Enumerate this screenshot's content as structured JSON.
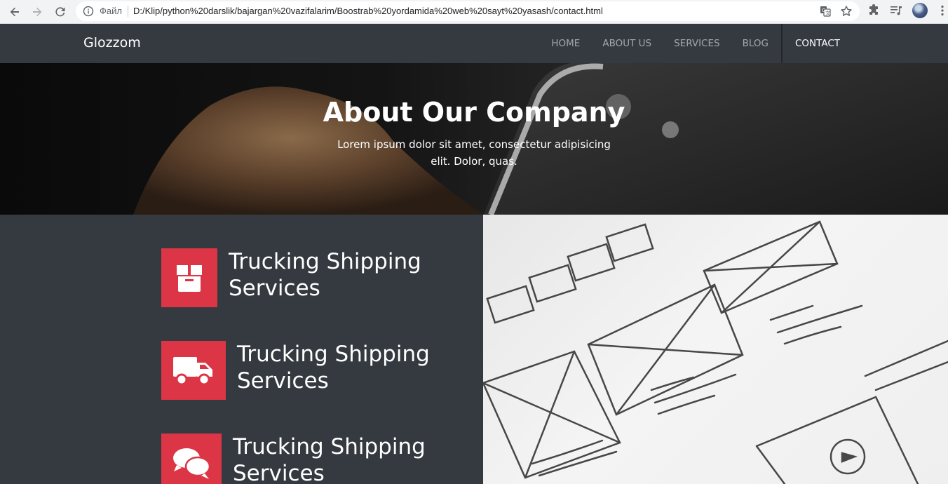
{
  "browser": {
    "scheme_label": "Файл",
    "url": "D:/Klip/python%20darslik/bajargan%20vazifalarim/Boostrab%20yordamida%20web%20sayt%20yasash/contact.html",
    "icons": [
      "back-icon",
      "forward-icon",
      "reload-icon",
      "info-icon",
      "translate-icon",
      "star-icon",
      "extensions-icon",
      "media-icon",
      "profile-avatar",
      "menu-icon"
    ]
  },
  "navbar": {
    "brand": "Glozzom",
    "links": [
      {
        "label": "HOME",
        "active": false
      },
      {
        "label": "ABOUT US",
        "active": false
      },
      {
        "label": "SERVICES",
        "active": false
      },
      {
        "label": "BLOG",
        "active": false
      },
      {
        "label": "CONTACT",
        "active": true
      }
    ]
  },
  "hero": {
    "title": "About Our Company",
    "text": "Lorem ipsum dolor sit amet, consectetur adipisicing elit. Dolor, quas."
  },
  "services": {
    "accent_color": "#dc3545",
    "items": [
      {
        "icon": "box-icon",
        "title": "Trucking Shipping Services"
      },
      {
        "icon": "truck-icon",
        "title": "Trucking Shipping Services"
      },
      {
        "icon": "comments-icon",
        "title": "Trucking Shipping Services"
      }
    ]
  },
  "colors": {
    "navbar_bg": "#343a40",
    "accent": "#dc3545"
  }
}
